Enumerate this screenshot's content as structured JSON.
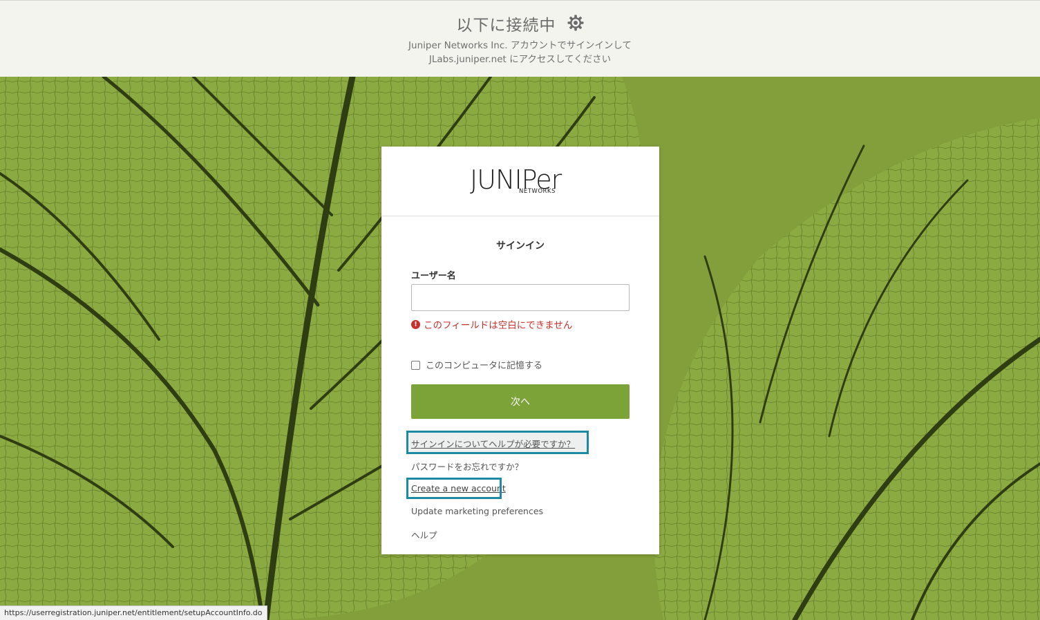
{
  "header": {
    "title": "以下に接続中",
    "title_icon": "gear-icon",
    "subtitle_line1": "Juniper Networks Inc. アカウントでサインインして",
    "subtitle_line2": "JLabs.juniper.net にアクセスしてください"
  },
  "logo": {
    "wordmark": "JUNIPer",
    "subtext": "NETWORKS"
  },
  "form": {
    "heading": "サインイン",
    "username_label": "ユーザー名",
    "username_value": "",
    "username_placeholder": "",
    "error_text": "このフィールドは空白にできません",
    "remember_label": "このコンピュータに記憶する",
    "remember_checked": false,
    "next_button": "次へ"
  },
  "links": {
    "signin_help": "サインインについてヘルプが必要ですか？",
    "forgot_password": "パスワードをお忘れですか？",
    "create_account": "Create a new account",
    "update_marketing": "Update marketing preferences",
    "help": "ヘルプ"
  },
  "status_bar": {
    "url": "https://userregistration.juniper.net/entitlement/setupAccountInfo.do"
  },
  "colors": {
    "accent_green": "#7ca337",
    "highlight_teal": "#1d8aa3",
    "error_red": "#c9302c",
    "background_leaf": "#829f3b"
  }
}
